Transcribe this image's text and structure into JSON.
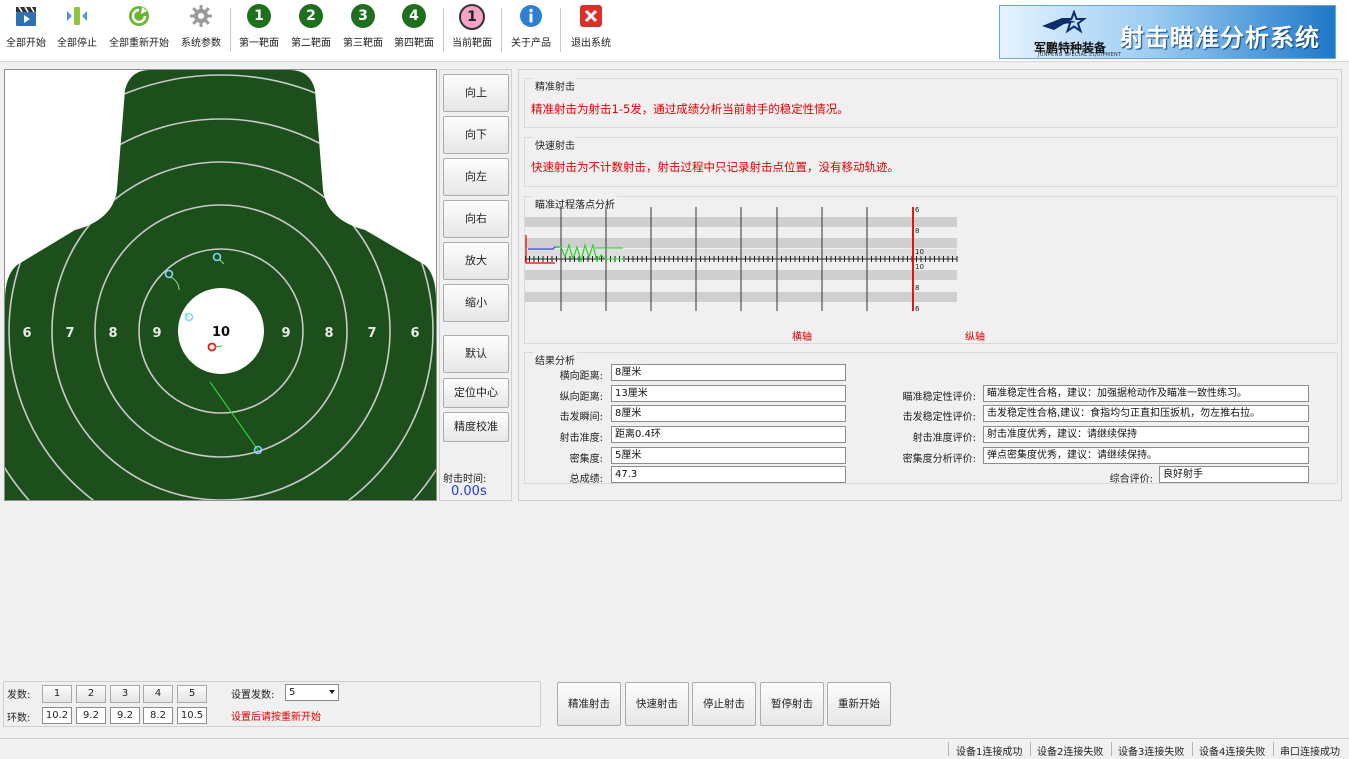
{
  "toolbar": {
    "start_all": "全部开始",
    "stop_all": "全部停止",
    "restart_all": "全部重新开始",
    "system_params": "系统参数",
    "target1": "第一靶面",
    "target2": "第二靶面",
    "target3": "第三靶面",
    "target4": "第四靶面",
    "current_target": "当前靶面",
    "about": "关于产品",
    "exit": "退出系统",
    "round_numbers": [
      "1",
      "2",
      "3",
      "4"
    ],
    "current_number": "1"
  },
  "brand": {
    "company": "军鹏特种装备",
    "company_en": "JUNPENG SPECIAL EQUIPMENT",
    "title": "射击瞄准分析系统"
  },
  "target": {
    "ring_labels_left": [
      "6",
      "7",
      "8",
      "9"
    ],
    "center_label": "10",
    "ring_labels_right": [
      "9",
      "8",
      "7",
      "6"
    ],
    "colors": {
      "ring_fill": "#1c4f1c",
      "ring_line": "#c9c9c9",
      "center": "#ffffff"
    }
  },
  "controls": {
    "up": "向上",
    "down": "向下",
    "left": "向左",
    "right": "向右",
    "zoom_in": "放大",
    "zoom_out": "缩小",
    "default": "默认",
    "locate_center": "定位中心",
    "calibrate": "精度校准",
    "shoot_time_label": "射击时间:",
    "shoot_time_value": "0.00s"
  },
  "precise": {
    "title": "精准射击",
    "desc": "精准射击为射击1-5发，通过成绩分析当前射手的稳定性情况。"
  },
  "rapid": {
    "title": "快速射击",
    "desc": "快速射击为不计数射击，射击过程中只记录射击点位置，没有移动轨迹。"
  },
  "aim_analysis": {
    "title": "瞄准过程落点分析",
    "scale_labels": [
      "6",
      "8",
      "10",
      "10",
      "8",
      "6"
    ],
    "x_axis_label": "横轴",
    "y_axis_label": "纵轴"
  },
  "results": {
    "title": "结果分析",
    "left": [
      {
        "label": "横向距离:",
        "value": "8厘米"
      },
      {
        "label": "纵向距离:",
        "value": "13厘米"
      },
      {
        "label": "击发瞬间:",
        "value": "8厘米"
      },
      {
        "label": "射击准度:",
        "value": "距离0.4环"
      },
      {
        "label": "密集度:",
        "value": "5厘米"
      },
      {
        "label": "总成绩:",
        "value": "47.3"
      }
    ],
    "right": [
      {
        "label": "瞄准稳定性评价:",
        "value": "瞄准稳定性合格，建议：加强据枪动作及瞄准一致性练习。"
      },
      {
        "label": "击发稳定性评价:",
        "value": "击发稳定性合格,建议：食指均匀正直扣压扳机，勿左推右拉。"
      },
      {
        "label": "射击准度评价:",
        "value": "射击准度优秀，建议：请继续保持"
      },
      {
        "label": "密集度分析评价:",
        "value": "弹点密集度优秀，建议：请继续保持。"
      }
    ],
    "overall_label": "综合评价:",
    "overall_value": "良好射手"
  },
  "settings": {
    "shots_label": "发数:",
    "shots": [
      "1",
      "2",
      "3",
      "4",
      "5"
    ],
    "rings_label": "环数:",
    "rings": [
      "10.2",
      "9.2",
      "9.2",
      "8.2",
      "10.5"
    ],
    "set_shots_label": "设置发数:",
    "set_shots_value": "5",
    "restart_hint": "设置后请按重新开始"
  },
  "actions": {
    "precise_shoot": "精准射击",
    "rapid_shoot": "快速射击",
    "stop_shoot": "停止射击",
    "pause_shoot": "暂停射击",
    "restart": "重新开始"
  },
  "status": {
    "device1": "设备1连接成功",
    "device2": "设备2连接失败",
    "device3": "设备3连接失败",
    "device4": "设备4连接失败",
    "serial": "串口连接成功"
  }
}
